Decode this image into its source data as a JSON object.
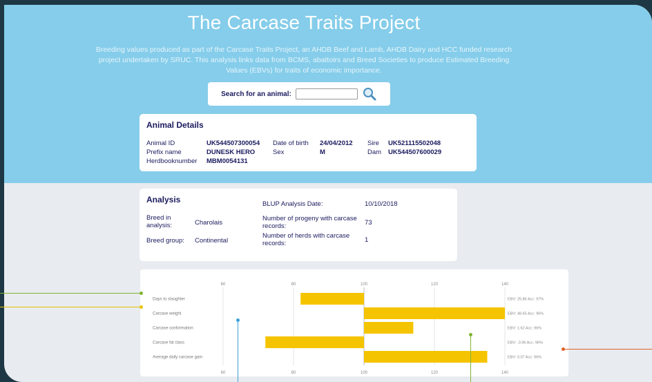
{
  "header": {
    "title": "The Carcase Traits Project",
    "description": "Breeding values produced as part of the Carcase Traits Project, an AHDB Beef and Lamb, AHDB Dairy and HCC funded research project undertaken by SRUC. This analysis links data from BCMS, abattoirs and Breed Societies to produce Estimated Breeding Values (EBVs) for traits of economic importance."
  },
  "search": {
    "label": "Search for an animal:",
    "value": "",
    "placeholder": "",
    "icon": "magnifier-icon"
  },
  "animal_details": {
    "title": "Animal Details",
    "animal_id_label": "Animal ID",
    "animal_id": "UK544507300054",
    "prefix_label": "Prefix name",
    "prefix": "DUNESK HERO",
    "herdbook_label": "Herdbooknumber",
    "herdbook": "MBM0054131",
    "dob_label": "Date of birth",
    "dob": "24/04/2012",
    "sex_label": "Sex",
    "sex": "M",
    "sire_label": "Sire",
    "sire": "UK521115502048",
    "dam_label": "Dam",
    "dam": "UK544507600029"
  },
  "analysis": {
    "title": "Analysis",
    "breed_label": "Breed in analysis:",
    "breed": "Charolais",
    "group_label": "Breed group:",
    "group": "Continental",
    "blup_label": "BLUP Analysis Date:",
    "blup": "10/10/2018",
    "progeny_label": "Number of progeny with carcase records:",
    "progeny": "73",
    "herds_label": "Number of herds with carcase records:",
    "herds": "1"
  },
  "chart_data": {
    "type": "bar",
    "orientation": "horizontal",
    "baseline": 100,
    "xlim": [
      60,
      140
    ],
    "xticks": [
      60,
      80,
      100,
      120,
      140
    ],
    "categories": [
      "Days to slaughter",
      "Carcase weight",
      "Carcase conformation",
      "Carcase fat class",
      "Average daily carcase gain"
    ],
    "values": [
      82,
      140,
      114,
      72,
      135
    ],
    "annotations": [
      "EBV: 25.86  Acc: 97%",
      "EBV: 48.65  Acc: 96%",
      "EBV: 1.62  Acc: 96%",
      "EBV: -3.96  Acc: 96%",
      "EBV: 0.07  Acc: 96%"
    ],
    "bar_color": "#f5c400",
    "grid": true
  },
  "callout_colors": {
    "green": "#7fb431",
    "yellow": "#e8c300",
    "blue": "#3aa0d8",
    "orange": "#e0622a"
  }
}
